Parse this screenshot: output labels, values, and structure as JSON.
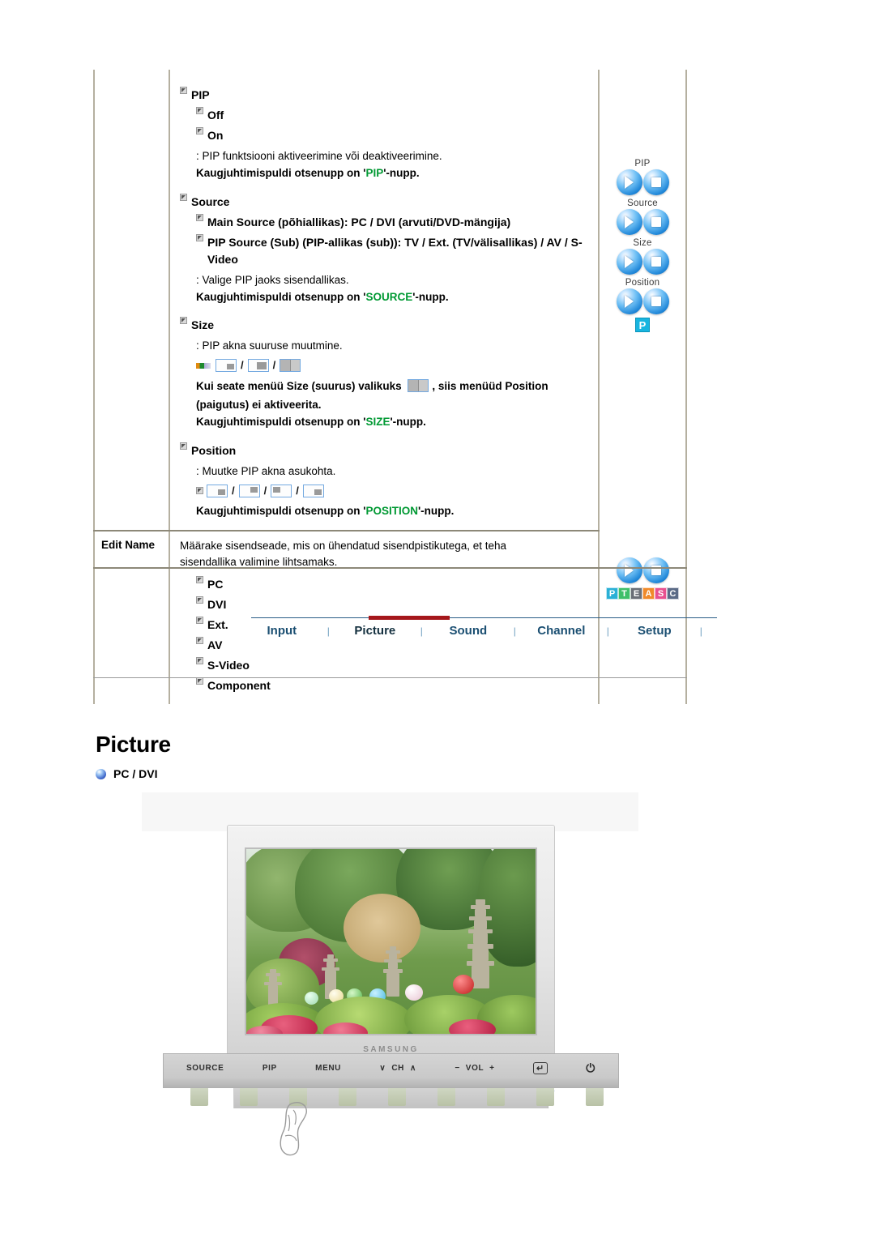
{
  "table": {
    "rows": [
      {
        "label": "",
        "sections": [
          {
            "title": "PIP",
            "options": [
              "Off",
              "On"
            ],
            "desc": ": PIP funktsiooni aktiveerimine või deaktiveerimine.",
            "remote_prefix": "Kaugjuhtimispuldi otsenupp on '",
            "remote_key": "PIP",
            "remote_suffix": "'-nupp."
          },
          {
            "title": "Source",
            "options": [
              "Main Source (põhiallikas): PC / DVI (arvuti/DVD-mängija)",
              "PIP Source (Sub) (PIP-allikas (sub)): TV / Ext. (TV/välisallikas) / AV / S-Video"
            ],
            "desc": ": Valige PIP jaoks sisendallikas.",
            "remote_prefix": "Kaugjuhtimispuldi otsenupp on '",
            "remote_key": "SOURCE",
            "remote_suffix": "'-nupp."
          },
          {
            "title": "Size",
            "desc": ": PIP akna suuruse muutmine.",
            "note_a": "Kui seate menüü Size (suurus) valikuks",
            "note_b": ", siis menüüd Position",
            "note_c": "(paigutus) ei aktiveerita.",
            "remote_prefix": "Kaugjuhtimispuldi otsenupp on '",
            "remote_key": "SIZE",
            "remote_suffix": "'-nupp."
          },
          {
            "title": "Position",
            "desc": ": Muutke PIP akna asukohta.",
            "remote_prefix": "Kaugjuhtimispuldi otsenupp on '",
            "remote_key": "POSITION",
            "remote_suffix": "'-nupp."
          }
        ],
        "side_buttons": [
          {
            "label": "PIP"
          },
          {
            "label": "Source"
          },
          {
            "label": "Size"
          },
          {
            "label": "Position"
          }
        ],
        "side_badge": "P"
      },
      {
        "label": "Edit Name",
        "body_line1": "Määrake sisendseade, mis on ühendatud sisendpistikutega, et teha",
        "body_line2": "sisendallika valimine lihtsamaks.",
        "options": [
          "PC",
          "DVI",
          "Ext.",
          "AV",
          "S-Video",
          "Component"
        ],
        "side_letters": [
          {
            "ch": "P",
            "color": "#2ab0d6"
          },
          {
            "ch": "T",
            "color": "#3fbf6a"
          },
          {
            "ch": "E",
            "color": "#6a6f77"
          },
          {
            "ch": "A",
            "color": "#f08a2a"
          },
          {
            "ch": "S",
            "color": "#e8508f"
          },
          {
            "ch": "C",
            "color": "#5a6a86"
          }
        ]
      }
    ]
  },
  "nav": {
    "items": [
      {
        "label": "Input",
        "active": false
      },
      {
        "label": "Picture",
        "active": true
      },
      {
        "label": "Sound",
        "active": false
      },
      {
        "label": "Channel",
        "active": false
      },
      {
        "label": "Setup",
        "active": false
      }
    ],
    "separator": "|",
    "active_color": "#a5171b"
  },
  "page": {
    "title": "Picture",
    "subhead": "PC / DVI"
  },
  "product": {
    "brand": "SAMSUNG",
    "controls": {
      "source": "SOURCE",
      "pip": "PIP",
      "menu": "MENU",
      "ch_down": "∨",
      "ch": "CH",
      "ch_up": "∧",
      "vol_minus": "−",
      "vol": "VOL",
      "vol_plus": "+",
      "enter": "↵",
      "power": "⏻"
    }
  },
  "colors": {
    "green_key": "#009933",
    "accent_red": "#a5171b",
    "nav_blue": "#1b4f72",
    "table_border": "#b5b0a0"
  }
}
